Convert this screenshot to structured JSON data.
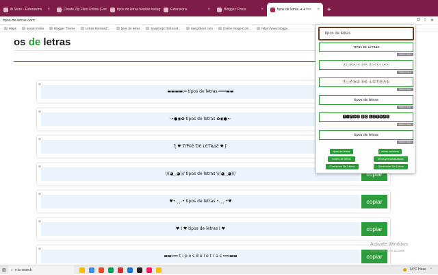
{
  "browser": {
    "tabs": [
      {
        "label": "ib Store - Extensions",
        "active": false
      },
      {
        "label": "Create Zip Files Online (Fast!)",
        "active": false
      },
      {
        "label": "tipos de letras bonitas instagram",
        "active": false
      },
      {
        "label": "Extensions",
        "active": false
      },
      {
        "label": "Blogger: Posts",
        "active": false
      },
      {
        "label": "tipos de letras ➜ ♦ ᵗⁱᵖᵒˢ",
        "active": true
      }
    ],
    "new_tab_label": "+",
    "url": "tipos-de-letras.com",
    "bookmarks": [
      "Maps",
      "social media",
      "Blogger Theme",
      "Letras Bonitas|C...",
      "tipos de letras",
      "JavaScript Obfuscat...",
      "raw.githack.com",
      "Online Image Com...",
      "https://www.blogge..."
    ]
  },
  "site": {
    "title_start": "os ",
    "title_green": "de",
    "title_end": " letras"
  },
  "cards": [
    {
      "tag": "07",
      "text": "▬▬▬▬ι═ tipos de letras ═══▬▬",
      "copy": ""
    },
    {
      "tag": "07",
      "text": "◦•●◉✿ tipos de letras ✿◉●•◦",
      "copy": ""
    },
    {
      "tag": "07",
      "text": "ƪ ♥ ƬƖƤ0Ƨ ƊЄ ԼЄƬƦ∆Ƨ ♥ ʃ",
      "copy": ""
    },
    {
      "tag": "07",
      "text": "\\\\(◕‿◕)// tipos de letras \\\\(◕‿◕)//",
      "copy": "copiar"
    },
    {
      "tag": "07",
      "text": "♥•.¸¸.• tipos de letras •.¸¸.•♥",
      "copy": "copiar"
    },
    {
      "tag": "07",
      "text": "♥ I ♥ tipos de letras I ♥",
      "copy": "copiar"
    },
    {
      "tag": "07",
      "text": "▬▬ι══ t i p o s d e l e t r a s ══ι▬▬",
      "copy": "copiar"
    }
  ],
  "popup": {
    "input_value": "tipos de letras",
    "styles": [
      "ᴛɪᴘᴏꜱ ᴅᴇ ʟᴇᴛʀᴀꜱ",
      "ⓣⓘⓟⓞⓢ ⓓⓔ ⓛⓔⓣⓡⓐⓢ",
      "ⓉⒾⓅⓄⓈ ⒹⒺ ⓁⒺⓉⓇⒶⓈ",
      "tipos de letras",
      "🆃🅸🅿🅾🆂 🅳🅴 🅻🅴🆃🆁🅰🆂",
      "tipos de letras"
    ],
    "copy_label": "Click to Copy",
    "buttons": [
      "tipos de letras",
      "letras cursivas",
      "fontes de letras",
      "letras personalizadas",
      "Conversor De Letras",
      "Generador De Letras"
    ]
  },
  "watermark": {
    "line1": "Activate Windows",
    "line2": "Go to Settings to activate"
  },
  "taskbar": {
    "search_text": "e to search",
    "weather": "34°C Haze",
    "icon_colors": [
      "#ffb900",
      "#3a8ee6",
      "#e34c26",
      "#0f9d58",
      "#d32f2f",
      "#1976d2",
      "#222222",
      "#e91e63",
      "#fbbc04"
    ]
  },
  "colors": {
    "accent_green": "#2e9c3a",
    "browser_tab_bar": "#7d1d47"
  }
}
